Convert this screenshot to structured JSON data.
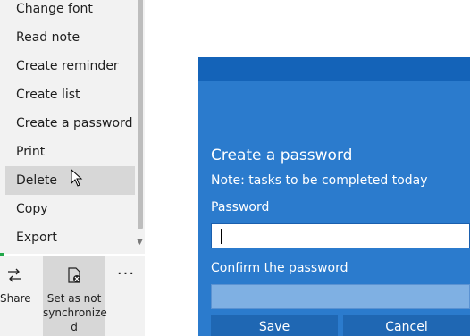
{
  "menu": {
    "items": [
      {
        "label": "Change font"
      },
      {
        "label": "Read note"
      },
      {
        "label": "Create reminder"
      },
      {
        "label": "Create list"
      },
      {
        "label": "Create a password"
      },
      {
        "label": "Print"
      },
      {
        "label": "Delete"
      },
      {
        "label": "Copy"
      },
      {
        "label": "Export"
      }
    ],
    "hovered_item": "Delete"
  },
  "command_bar": {
    "share_label": "Share",
    "sync_label_line1": "Set as not",
    "sync_label_line2": "synchronize",
    "sync_label_line3": "d",
    "more_label": "···",
    "icons": [
      "share-icon",
      "sync-off-icon",
      "more-icon"
    ]
  },
  "dialog": {
    "title": "Create a password",
    "note": "Note: tasks to be completed today",
    "password_label": "Password",
    "password_value": "",
    "confirm_label": "Confirm the password",
    "confirm_value": "",
    "save_label": "Save",
    "cancel_label": "Cancel"
  },
  "colors": {
    "dialog_bg": "#2b7bcd",
    "dialog_header": "#1463b8",
    "button_bg": "#1f67b3",
    "menu_bg": "#f2f2f2",
    "menu_hover": "#d7d7d7"
  }
}
